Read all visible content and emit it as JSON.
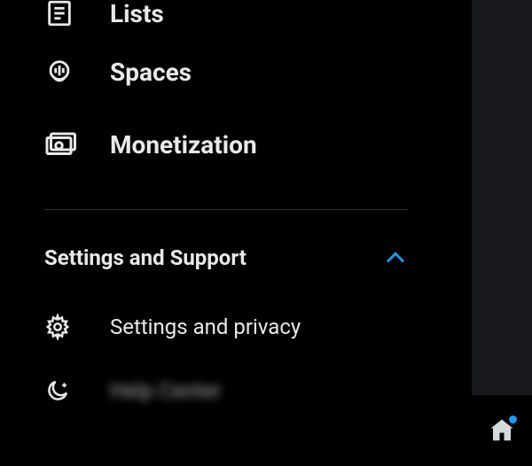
{
  "menu": {
    "lists": {
      "label": "Lists"
    },
    "spaces": {
      "label": "Spaces"
    },
    "monetization": {
      "label": "Monetization"
    }
  },
  "section": {
    "header": "Settings and Support",
    "items": {
      "settings_privacy": {
        "label": "Settings and privacy"
      },
      "help_center": {
        "label": "Help Center"
      }
    }
  }
}
